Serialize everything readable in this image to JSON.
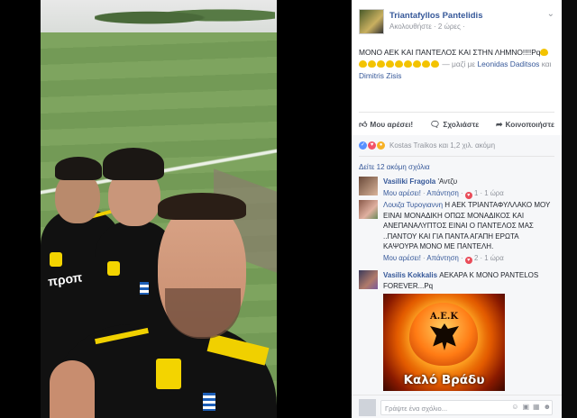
{
  "post": {
    "author": "Triantafyllos Pantelidis",
    "meta": "Ακολουθήστε · 2 ώρες ·",
    "text_main": "ΜΟΝΟ ΑΕΚ ΚΑΙ ΠΑΝΤΕΛΟΣ ΚΑΙ ΣΤΗΝ ΛΗΜΝΟ!!!!Pq",
    "with_text": " — μαζί με ",
    "tag1": "Leonidas Daditsos",
    "and_text": " και ",
    "tag2": "Dimitris Zisis",
    "heart_color": "#f3c300"
  },
  "photo": {
    "sponsor": "προπ"
  },
  "actions": {
    "like": "Μου αρέσει!",
    "comment": "Σχολιάστε",
    "share": "Κοινοποιήστε"
  },
  "reactions": {
    "text": "Kostas Traikos και 1,2 χιλ. ακόμη"
  },
  "comments_link": "Δείτε 12 ακόμη σχόλια",
  "comments": [
    {
      "name": "Vasiliki Fragola",
      "text": " 'Αντζυ",
      "like": "Μου αρέσει!",
      "reply": "Απάντηση",
      "count": "1",
      "time": "1 ώρα"
    },
    {
      "name": "Λουιζα Τυρογιαννη",
      "text": " Η ΑΕΚ ΤΡΙΑΝΤΑΦΥΛΛΑΚΟ ΜΟΥ ΕΙΝΑΙ ΜΟΝΑΔΙΚΗ ΟΠΩΣ ΜΟΝΑΔΙΚΟΣ ΚΑΙ ΑΝΕΠΑΝΑΛΥΠΤΟΣ ΕΙΝΑΙ Ο ΠΑΝΤΕΛΟΣ ΜΑΣ ..ΠΑΝΤΟΥ ΚΑΙ ΓΙΑ ΠΑΝΤΑ ΑΓΑΠΗ ΕΡΩΤΑ ΚΑΨΟΥΡΑ ΜΟΝΟ ΜΕ ΠΑΝΤΕΛΗ.",
      "like": "Μου αρέσει!",
      "reply": "Απάντηση",
      "count": "2",
      "time": "1 ώρα"
    },
    {
      "name": "Vasilis Kokkalis",
      "text": " ΑΕΚΑΡΑ Κ ΜΟΝΟ PANTELOS FOREVER...Pq"
    }
  ],
  "image": {
    "greek_top": "Α.Ε.Κ",
    "caption": "Καλό Βράδυ"
  },
  "compose": {
    "placeholder": "Γράψτε ένα σχόλιο..."
  }
}
